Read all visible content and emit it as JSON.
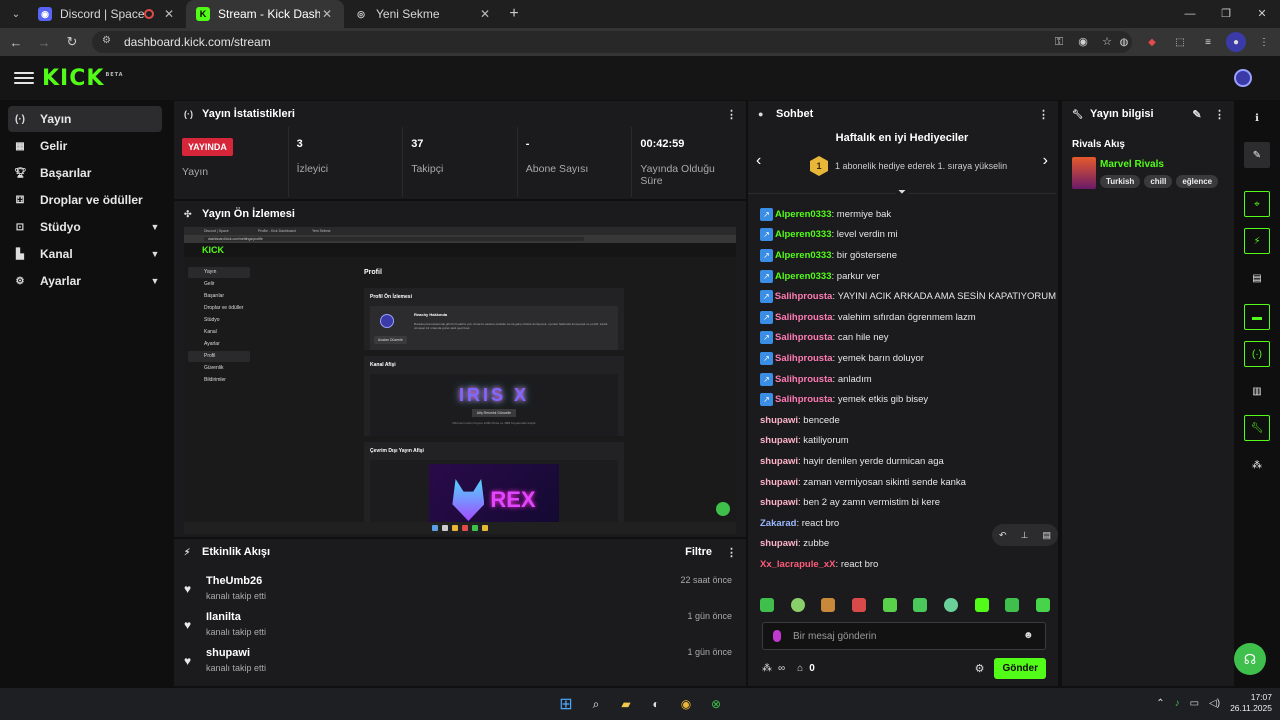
{
  "browser": {
    "tabs": [
      {
        "title": "Discord | Space"
      },
      {
        "title": "Stream - Kick Dashboard"
      },
      {
        "title": "Yeni Sekme"
      }
    ],
    "url": "dashboard.kick.com/stream",
    "new_tab_symbol": "+"
  },
  "app": {
    "logo": "KICK",
    "beta": "BETA"
  },
  "sidebar": {
    "items": [
      {
        "label": "Yayın",
        "icon": "broadcast-icon"
      },
      {
        "label": "Gelir",
        "icon": "revenue-icon"
      },
      {
        "label": "Başarılar",
        "icon": "trophy-icon"
      },
      {
        "label": "Droplar ve ödüller",
        "icon": "drops-icon"
      },
      {
        "label": "Stüdyo",
        "icon": "studio-icon"
      },
      {
        "label": "Kanal",
        "icon": "channel-icon"
      },
      {
        "label": "Ayarlar",
        "icon": "settings-icon"
      }
    ]
  },
  "stats_panel": {
    "title": "Yayın İstatistikleri",
    "live_badge": "YAYINDA",
    "live_label": "Yayın",
    "viewers_value": "3",
    "viewers_label": "İzleyici",
    "followers_value": "37",
    "followers_label": "Takipçi",
    "subs_value": "-",
    "subs_label": "Abone Sayısı",
    "uptime_value": "00:42:59",
    "uptime_label": "Yayında Olduğu Süre"
  },
  "preview_panel": {
    "title": "Yayın Ön İzlemesi",
    "mini": {
      "tabs": [
        "Discord | Space",
        "Profile - Kick Dashboard",
        "Yeni Sekme"
      ],
      "url": "dashboard.kick.com/settings/profile",
      "logo": "KICK",
      "side": [
        "Yayın",
        "Gelir",
        "Başarılar",
        "Droplar ve ödüller",
        "Stüdyo",
        "Kanal",
        "Ayarlar",
        "Profil",
        "Güvenlik",
        "Bildirimler"
      ],
      "page_title": "Profil",
      "card1_title": "Profil Ön İzlemesi",
      "profile_name": "Reachy Hakkında",
      "profile_desc": "Burada para kazanmak gibi bir hedefim yok. Amacım sadece okuldan sonra gelip sizlerle derleşmek, oyunlar hakkında konuşmak ve pozitif, toksik olmayan bir ortamda güzel vakit geçirmek.",
      "profile_btn": "Avatarı Düzenle",
      "card2_title": "Kanal Afişi",
      "banner_text": "IRIS X",
      "banner_btn": "Afiş Resmini Güncelle",
      "banner_hint": "Minimum resim boyutu 1200×Önbe ve 4MB boyutundan küçük",
      "card3_title": "Çevrim Dışı Yayın Afişi",
      "offline_text": "REX"
    }
  },
  "activity_panel": {
    "title": "Etkinlik Akışı",
    "filter_label": "Filtre",
    "items": [
      {
        "name": "TheUmb26",
        "action": "kanalı takip etti",
        "time": "22 saat önce"
      },
      {
        "name": "Ilanilta",
        "action": "kanalı takip etti",
        "time": "1 gün önce"
      },
      {
        "name": "shupawi",
        "action": "kanalı takip etti",
        "time": "1 gün önce"
      }
    ]
  },
  "chat_panel": {
    "title": "Sohbet",
    "gifter_title": "Haftalık en iyi Hediyeciler",
    "gifter_rank": "1",
    "gifter_msg": "1 abonelik hediye ederek 1. sıraya yükselin",
    "messages": [
      {
        "user": "Alperen0333",
        "color": "#53fc18",
        "badge": true,
        "text": "mermiye bak"
      },
      {
        "user": "Alperen0333",
        "color": "#53fc18",
        "badge": true,
        "text": "level verdin mi"
      },
      {
        "user": "Alperen0333",
        "color": "#53fc18",
        "badge": true,
        "text": "bir göstersene"
      },
      {
        "user": "Alperen0333",
        "color": "#53fc18",
        "badge": true,
        "text": "parkur ver"
      },
      {
        "user": "Salihprousta",
        "color": "#ff7bb5",
        "badge": true,
        "text": "YAYINI ACIK ARKADA AMA SESİN KAPATIYORUM"
      },
      {
        "user": "Salihprousta",
        "color": "#ff7bb5",
        "badge": true,
        "text": "valehim sıfırdan ögrenmem lazm"
      },
      {
        "user": "Salihprousta",
        "color": "#ff7bb5",
        "badge": true,
        "text": "can hile ney"
      },
      {
        "user": "Salihprousta",
        "color": "#ff7bb5",
        "badge": true,
        "text": "yemek barın doluyor"
      },
      {
        "user": "Salihprousta",
        "color": "#ff7bb5",
        "badge": true,
        "text": "anladım"
      },
      {
        "user": "Salihprousta",
        "color": "#ff7bb5",
        "badge": true,
        "text": "yemek etkis gib bisey"
      },
      {
        "user": "shupawi",
        "color": "#ffb3c9",
        "badge": false,
        "text": "bencede"
      },
      {
        "user": "shupawi",
        "color": "#ffb3c9",
        "badge": false,
        "text": "katiliyorum"
      },
      {
        "user": "shupawi",
        "color": "#ffb3c9",
        "badge": false,
        "text": "hayir denilen yerde durmican aga"
      },
      {
        "user": "shupawi",
        "color": "#ffb3c9",
        "badge": false,
        "text": "zaman vermiyosan sikinti sende kanka"
      },
      {
        "user": "shupawi",
        "color": "#ffb3c9",
        "badge": false,
        "text": "ben 2 ay zamn vermistim bi kere"
      },
      {
        "user": "Zakarad",
        "color": "#9ab8ff",
        "badge": false,
        "text": "react bro"
      },
      {
        "user": "shupawi",
        "color": "#ffb3c9",
        "badge": false,
        "text": "zubbe"
      },
      {
        "user": "Xx_lacrapule_xX",
        "color": "#ff5c7a",
        "badge": false,
        "text": "react bro"
      }
    ],
    "input_placeholder": "Bir mesaj gönderin",
    "points_count": "0",
    "send_label": "Gönder"
  },
  "info_panel": {
    "title": "Yayın bilgisi",
    "stream_title": "Rivals Akış",
    "category": "Marvel Rivals",
    "tags": [
      "Turkish",
      "chill",
      "eğlence"
    ]
  },
  "taskbar": {
    "time": "17:07",
    "date": "26.11.2025"
  },
  "colors": {
    "accent": "#53fc18",
    "live": "#d6263a",
    "panel": "#1b1b1d",
    "background": "#0f0f10"
  }
}
